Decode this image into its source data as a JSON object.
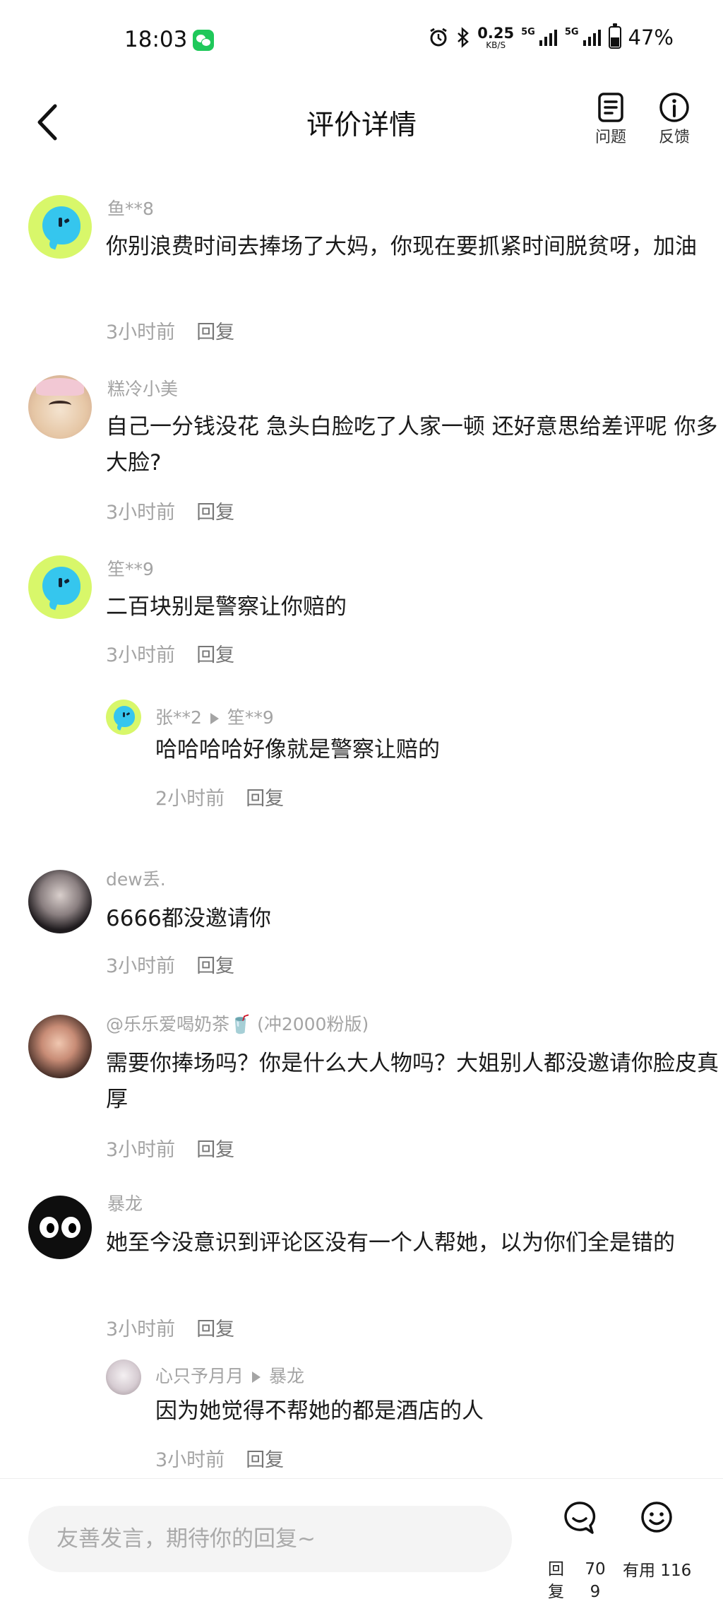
{
  "status_bar": {
    "time": "18:03",
    "net_speed_value": "0.25",
    "net_speed_unit": "KB/S",
    "signal1_label": "5G",
    "signal2_label": "5G",
    "battery": "47%"
  },
  "header": {
    "title": "评价详情",
    "issue_label": "问题",
    "feedback_label": "反馈"
  },
  "comments": [
    {
      "user": "鱼**8",
      "text": "你别浪费时间去捧场了大妈，你现在要抓紧时间脱贫呀，加油",
      "time": "3小时前",
      "reply": "回复"
    },
    {
      "user": "糕冷小美",
      "text": "自己一分钱没花 急头白脸吃了人家一顿 还好意思给差评呢 你多大脸?",
      "time": "3小时前",
      "reply": "回复"
    },
    {
      "user": "笙**9",
      "text": "二百块别是警察让你赔的",
      "time": "3小时前",
      "reply": "回复"
    },
    {
      "user": "张**2",
      "reply_to": "笙**9",
      "text": "哈哈哈哈好像就是警察让赔的",
      "time": "2小时前",
      "reply": "回复"
    },
    {
      "user": "dew丢.",
      "text": "6666都没邀请你",
      "time": "3小时前",
      "reply": "回复"
    },
    {
      "user": "@乐乐爱喝奶茶🥤 (冲2000粉版)",
      "text": "需要你捧场吗？你是什么大人物吗？大姐别人都没邀请你脸皮真厚",
      "time": "3小时前",
      "reply": "回复"
    },
    {
      "user": "暴龙",
      "text": "她至今没意识到评论区没有一个人帮她，以为你们全是错的",
      "time": "3小时前",
      "reply": "回复"
    },
    {
      "user": "心只予月月",
      "reply_to": "暴龙",
      "text": "因为她觉得不帮她的都是酒店的人",
      "time": "3小时前",
      "reply": "回复"
    }
  ],
  "bottom_bar": {
    "input_placeholder": "友善发言，期待你的回复~",
    "reply_label": "回复",
    "reply_count": "709",
    "useful_label": "有用 116"
  }
}
